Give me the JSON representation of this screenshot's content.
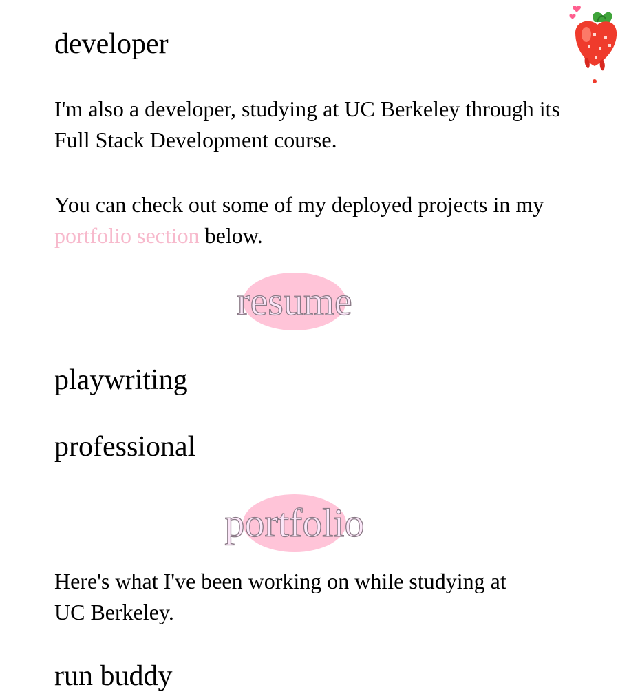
{
  "sections": {
    "developer_heading": "developer",
    "developer_para1": "I'm also a developer, studying at UC Berkeley through its Full Stack Development course.",
    "developer_para2_before": "You can check out some of my deployed projects in my ",
    "developer_para2_link": "portfolio section",
    "developer_para2_after": " below.",
    "resume_badge": "resume",
    "playwriting_heading": "playwriting",
    "professional_heading": "professional",
    "portfolio_badge": "portfolio",
    "portfolio_para": "Here's what I've been working on while studying at UC Berkeley.",
    "run_buddy_heading": "run buddy"
  },
  "icons": {
    "decoration": "strawberry-icon"
  },
  "colors": {
    "link": "#f7b9cc",
    "badge_blob": "#ffc4d8",
    "badge_text_fill": "#fbe6f8",
    "badge_text_stroke": "#8a7a86"
  }
}
